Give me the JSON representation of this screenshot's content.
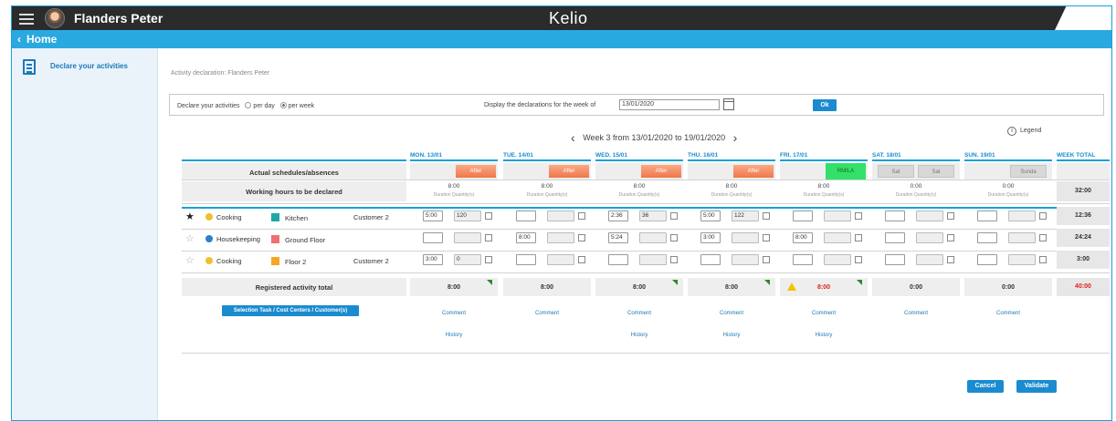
{
  "header": {
    "user_name": "Flanders Peter",
    "brand": "Kelio"
  },
  "nav": {
    "back_arrow": "‹",
    "home_label": "Home"
  },
  "sidebar": {
    "item_label": "Declare your activities",
    "item_icon": "clipboard-icon"
  },
  "page": {
    "title": "Activity declaration: Flanders Peter"
  },
  "filters": {
    "declare_label": "Declare your activities",
    "option_per_day": "per day",
    "option_per_week": "per week",
    "selected": "per week",
    "week_label": "Display the declarations for the week of",
    "week_date": "13/01/2020",
    "ok_label": "Ok"
  },
  "week_nav": {
    "label": "Week 3 from 13/01/2020 to 19/01/2020",
    "prev": "‹",
    "next": "›"
  },
  "legend_label": "Legend",
  "days": [
    {
      "label": "MON. 13/01",
      "schedule": "After",
      "schedule2": "",
      "hours": "8:00",
      "total": "8:00"
    },
    {
      "label": "TUE. 14/01",
      "schedule": "After",
      "schedule2": "",
      "hours": "8:00",
      "total": "8:00"
    },
    {
      "label": "WED. 15/01",
      "schedule": "After",
      "schedule2": "",
      "hours": "8:00",
      "total": "8:00"
    },
    {
      "label": "THU. 16/01",
      "schedule": "After",
      "schedule2": "",
      "hours": "8:00",
      "total": "8:00"
    },
    {
      "label": "FRI. 17/01",
      "schedule": "RMILA",
      "schedule2": "",
      "hours": "8:00",
      "total": "8:00"
    },
    {
      "label": "SAT. 18/01",
      "schedule": "Sat",
      "schedule2": "Sat",
      "hours": "0:00",
      "total": "0:00"
    },
    {
      "label": "SUN. 19/01",
      "schedule": "Sunda",
      "schedule2": "",
      "hours": "0:00",
      "total": "0:00"
    }
  ],
  "week_total_label": "WEEK TOTAL",
  "row_labels": {
    "schedules": "Actual schedules/absences",
    "hours": "Working hours to be declared",
    "registered": "Registered activity total"
  },
  "duration_label": "Duration",
  "quantity_label": "Quantity(s)",
  "hours_week_total": "32:00",
  "registered_week_total": "40:00",
  "activities": [
    {
      "star": "★",
      "task": "Cooking",
      "task_color": "#f2c02b",
      "location": "Kitchen",
      "location_color": "#1fa8a8",
      "customer": "Customer 2",
      "week_total": "12:36",
      "cells": [
        [
          "5:00",
          "120"
        ],
        [
          "",
          ""
        ],
        [
          "2:36",
          "36"
        ],
        [
          "5:00",
          "122"
        ],
        [
          "",
          ""
        ],
        [
          "",
          ""
        ],
        [
          "",
          ""
        ]
      ]
    },
    {
      "star": "☆",
      "task": "Housekeeping",
      "task_color": "#2c7fc8",
      "location": "Ground Floor",
      "location_color": "#f07070",
      "customer": "",
      "week_total": "24:24",
      "cells": [
        [
          "",
          ""
        ],
        [
          "8:00",
          ""
        ],
        [
          "5:24",
          ""
        ],
        [
          "3:00",
          ""
        ],
        [
          "8:00",
          ""
        ],
        [
          "",
          ""
        ],
        [
          "",
          ""
        ]
      ]
    },
    {
      "star": "☆",
      "task": "Cooking",
      "task_color": "#f2c02b",
      "location": "Floor 2",
      "location_color": "#f5a623",
      "customer": "Customer 2",
      "week_total": "3:00",
      "cells": [
        [
          "3:00",
          "0"
        ],
        [
          "",
          ""
        ],
        [
          "",
          ""
        ],
        [
          "",
          ""
        ],
        [
          "",
          ""
        ],
        [
          "",
          ""
        ],
        [
          "",
          ""
        ]
      ]
    }
  ],
  "comment_label": "Comment",
  "history_label": "History",
  "selection_button": "Selection Task / Cost Centers / Customer(s)",
  "cancel_label": "Cancel",
  "validate_label": "Validate",
  "colors": {
    "accent": "#1aa0d8",
    "button": "#1b8bd0",
    "header": "#2b2b2b",
    "schedule_orange": "#f0774a",
    "schedule_green": "#33e06a",
    "alert_red": "#e02020"
  }
}
